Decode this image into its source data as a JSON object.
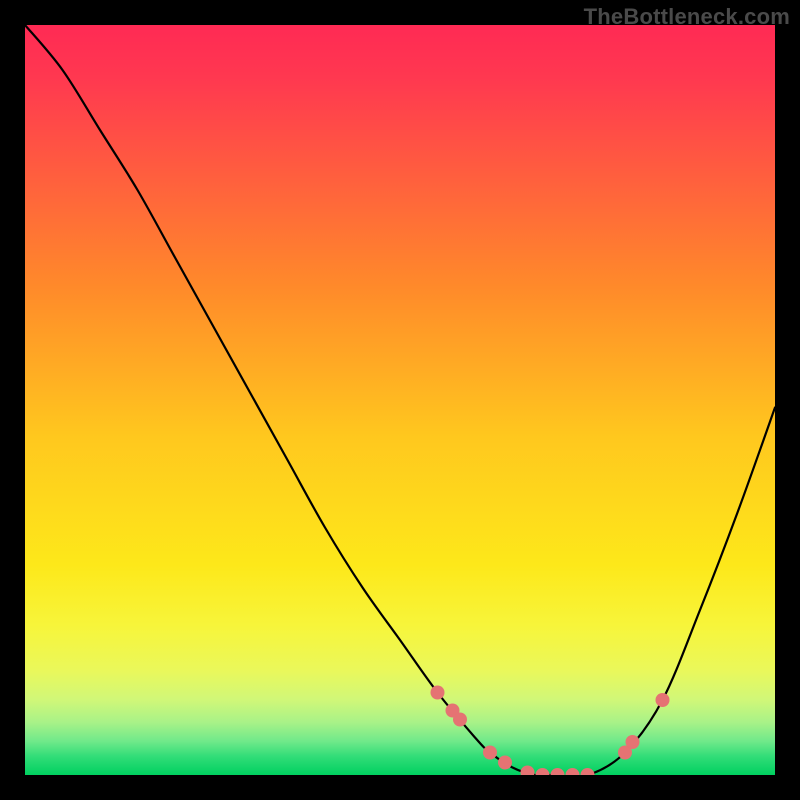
{
  "watermark": "TheBottleneck.com",
  "chart_data": {
    "type": "line",
    "title": "",
    "xlabel": "",
    "ylabel": "",
    "xlim": [
      0,
      100
    ],
    "ylim": [
      0,
      100
    ],
    "grid": false,
    "legend": false,
    "background_gradient": {
      "top": "#ff2a54",
      "mid": "#fedc00",
      "bottom": "#00d060"
    },
    "series": [
      {
        "name": "bottleneck-curve",
        "color": "#000000",
        "x": [
          0,
          5,
          10,
          15,
          20,
          25,
          30,
          35,
          40,
          45,
          50,
          55,
          60,
          62,
          65,
          68,
          70,
          75,
          80,
          85,
          90,
          95,
          100
        ],
        "y": [
          100,
          94,
          86,
          78,
          69,
          60,
          51,
          42,
          33,
          25,
          18,
          11,
          5,
          3,
          1,
          0,
          0,
          0,
          3,
          10,
          22,
          35,
          49
        ]
      }
    ],
    "highlight_points": {
      "color": "#e57373",
      "on_series": "bottleneck-curve",
      "x": [
        55,
        57,
        58,
        62,
        64,
        67,
        69,
        71,
        73,
        75,
        80,
        81,
        85
      ]
    }
  }
}
